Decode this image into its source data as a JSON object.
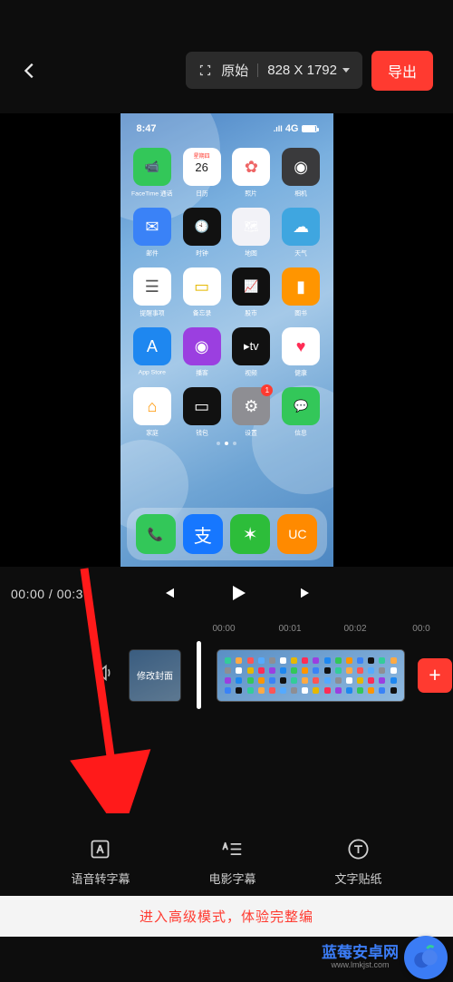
{
  "header": {
    "original_label": "原始",
    "dimensions": "828 X 1792",
    "export_label": "导出"
  },
  "preview": {
    "status_time": "8:47",
    "signal": "4G"
  },
  "apps": [
    {
      "label": "FaceTime 通话",
      "bg": "#33c759",
      "glyph": "📹"
    },
    {
      "label": "日历",
      "bg": "#ffffff",
      "glyph": "26",
      "top": "星期四",
      "fg": "#222"
    },
    {
      "label": "照片",
      "bg": "#ffffff",
      "glyph": "✿",
      "fg": "#e66"
    },
    {
      "label": "相机",
      "bg": "#3a3a3c",
      "glyph": "◉"
    },
    {
      "label": "邮件",
      "bg": "#3a82f7",
      "glyph": "✉"
    },
    {
      "label": "时钟",
      "bg": "#111",
      "glyph": "🕙"
    },
    {
      "label": "地图",
      "bg": "#f2f2f7",
      "glyph": "🗺"
    },
    {
      "label": "天气",
      "bg": "#3fa6e0",
      "glyph": "☁"
    },
    {
      "label": "提醒事项",
      "bg": "#ffffff",
      "glyph": "☰",
      "fg": "#555"
    },
    {
      "label": "备忘录",
      "bg": "#fff",
      "glyph": "▭",
      "fg": "#e6b800"
    },
    {
      "label": "股市",
      "bg": "#111",
      "glyph": "📈"
    },
    {
      "label": "图书",
      "bg": "#ff9500",
      "glyph": "▮"
    },
    {
      "label": "App Store",
      "bg": "#1e87f0",
      "glyph": "A"
    },
    {
      "label": "播客",
      "bg": "#9b3fe0",
      "glyph": "◉"
    },
    {
      "label": "视频",
      "bg": "#111",
      "glyph": "▸tv"
    },
    {
      "label": "健康",
      "bg": "#fff",
      "glyph": "♥",
      "fg": "#ff2d55"
    },
    {
      "label": "家庭",
      "bg": "#fff",
      "glyph": "⌂",
      "fg": "#ff9500"
    },
    {
      "label": "钱包",
      "bg": "#111",
      "glyph": "▭"
    },
    {
      "label": "设置",
      "bg": "#8e8e93",
      "glyph": "⚙",
      "badge": "1"
    },
    {
      "label": "信息",
      "bg": "#33c759",
      "glyph": "💬"
    }
  ],
  "dock": [
    {
      "bg": "#33c759",
      "glyph": "📞"
    },
    {
      "bg": "#1677ff",
      "glyph": "支"
    },
    {
      "bg": "#2dbd3a",
      "glyph": "✶"
    },
    {
      "bg": "#ff8a00",
      "glyph": "UC"
    }
  ],
  "playback": {
    "current": "00:00",
    "total": "00:3"
  },
  "ruler": [
    "00:00",
    "00:01",
    "00:02",
    "00:0"
  ],
  "cover_label": "修改封面",
  "tools": [
    {
      "name": "语音转字幕"
    },
    {
      "name": "电影字幕"
    },
    {
      "name": "文字贴纸"
    }
  ],
  "footer_text": "进入高级模式，体验完整编",
  "watermark": {
    "title": "蓝莓安卓网",
    "url": "www.lmkjst.com"
  }
}
